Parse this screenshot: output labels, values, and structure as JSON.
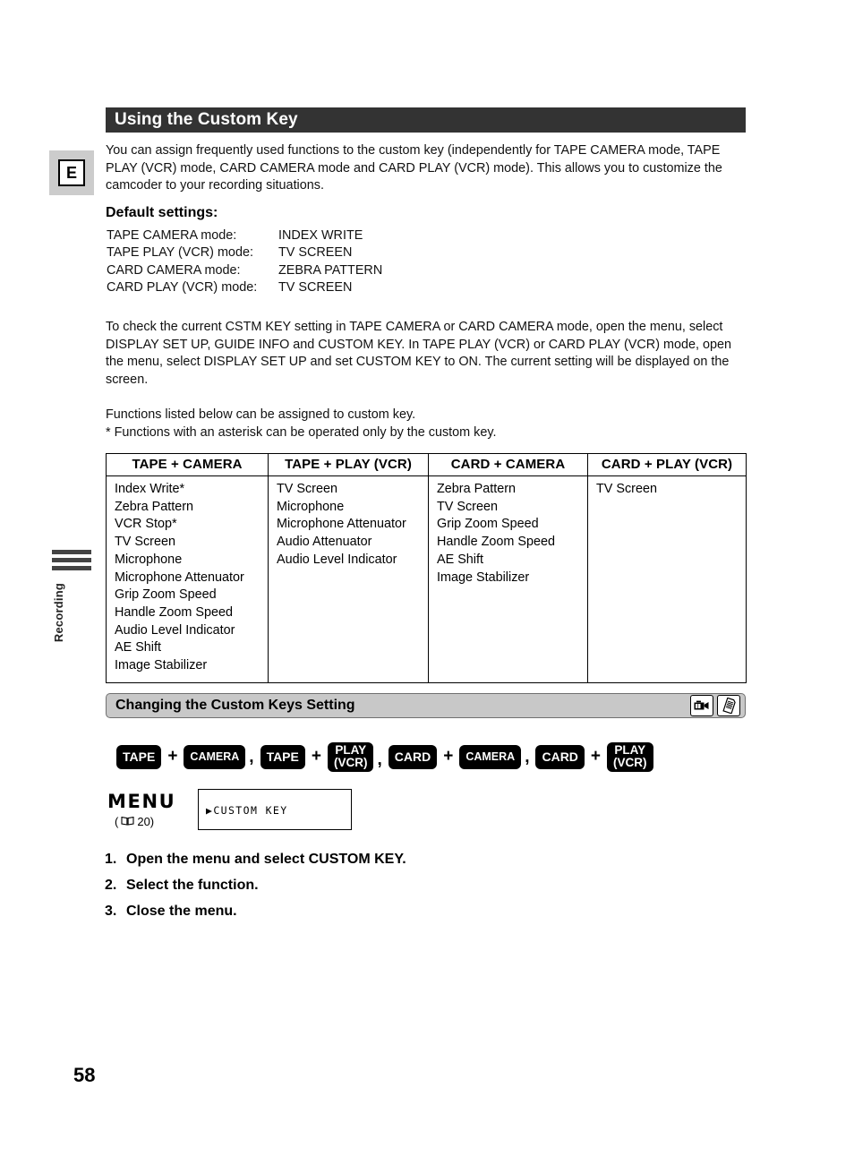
{
  "page": {
    "number": "58",
    "language_badge": "E",
    "side_tab_label": "Recording"
  },
  "header": {
    "title": "Using the Custom Key"
  },
  "intro": {
    "paragraph": "You can assign frequently used functions to the custom key (independently for TAPE CAMERA mode, TAPE PLAY (VCR) mode, CARD CAMERA mode and CARD PLAY (VCR) mode). This allows you to customize the camcoder to your recording situations."
  },
  "defaults": {
    "heading": "Default settings:",
    "rows": [
      {
        "mode": "TAPE CAMERA mode:",
        "value": "INDEX WRITE"
      },
      {
        "mode": "TAPE PLAY (VCR) mode:",
        "value": "TV SCREEN"
      },
      {
        "mode": "CARD CAMERA mode:",
        "value": "ZEBRA PATTERN"
      },
      {
        "mode": "CARD PLAY (VCR) mode:",
        "value": "TV SCREEN"
      }
    ]
  },
  "check_paragraph": "To check the current CSTM KEY setting in TAPE CAMERA or CARD CAMERA mode, open the menu, select DISPLAY SET UP, GUIDE INFO and CUSTOM KEY. In TAPE PLAY (VCR) or CARD PLAY (VCR) mode, open the menu, select DISPLAY SET UP and set CUSTOM KEY to ON. The current setting will be displayed on the screen.",
  "functions_note": {
    "line1": "Functions listed below can be assigned to custom key.",
    "line2": "* Functions with an asterisk can be operated only by the custom key."
  },
  "function_table": {
    "headers": [
      "TAPE + CAMERA",
      "TAPE + PLAY (VCR)",
      "CARD + CAMERA",
      "CARD + PLAY (VCR)"
    ],
    "columns": [
      [
        "Index Write*",
        "Zebra Pattern",
        "VCR Stop*",
        "TV Screen",
        "Microphone",
        "Microphone Attenuator",
        "Grip Zoom Speed",
        "Handle Zoom Speed",
        "Audio Level Indicator",
        "AE Shift",
        "Image Stabilizer"
      ],
      [
        "TV Screen",
        "Microphone",
        "Microphone Attenuator",
        "Audio Attenuator",
        "Audio Level Indicator"
      ],
      [
        "Zebra Pattern",
        "TV Screen",
        "Grip Zoom Speed",
        "Handle Zoom Speed",
        "AE Shift",
        "Image Stabilizer"
      ],
      [
        "TV Screen"
      ]
    ]
  },
  "section": {
    "title": "Changing the Custom Keys Setting",
    "icons": [
      "camcorder-icon",
      "memory-card-icon"
    ]
  },
  "key_combos": [
    {
      "first": "TAPE",
      "op": "+",
      "second": "CAMERA",
      "second_lines": [
        "CAMERA"
      ],
      "sep": ","
    },
    {
      "first": "TAPE",
      "op": "+",
      "second": "PLAY (VCR)",
      "second_lines": [
        "PLAY",
        "(VCR)"
      ],
      "sep": ","
    },
    {
      "first": "CARD",
      "op": "+",
      "second": "CAMERA",
      "second_lines": [
        "CAMERA"
      ],
      "sep": ","
    },
    {
      "first": "CARD",
      "op": "+",
      "second": "PLAY (VCR)",
      "second_lines": [
        "PLAY",
        "(VCR)"
      ],
      "sep": ""
    }
  ],
  "menu": {
    "label": "MENU",
    "reference_open": "(",
    "reference_page": "20)",
    "screen_item": "▶CUSTOM KEY"
  },
  "steps": [
    {
      "num": "1.",
      "text": "Open the menu and select CUSTOM KEY."
    },
    {
      "num": "2.",
      "text": "Select the function."
    },
    {
      "num": "3.",
      "text": "Close the menu."
    }
  ],
  "colors": {
    "title_bar": "#333333",
    "section_bar": "#c8c8c8",
    "badge_bg": "#cccccc",
    "key_button": "#000000"
  }
}
